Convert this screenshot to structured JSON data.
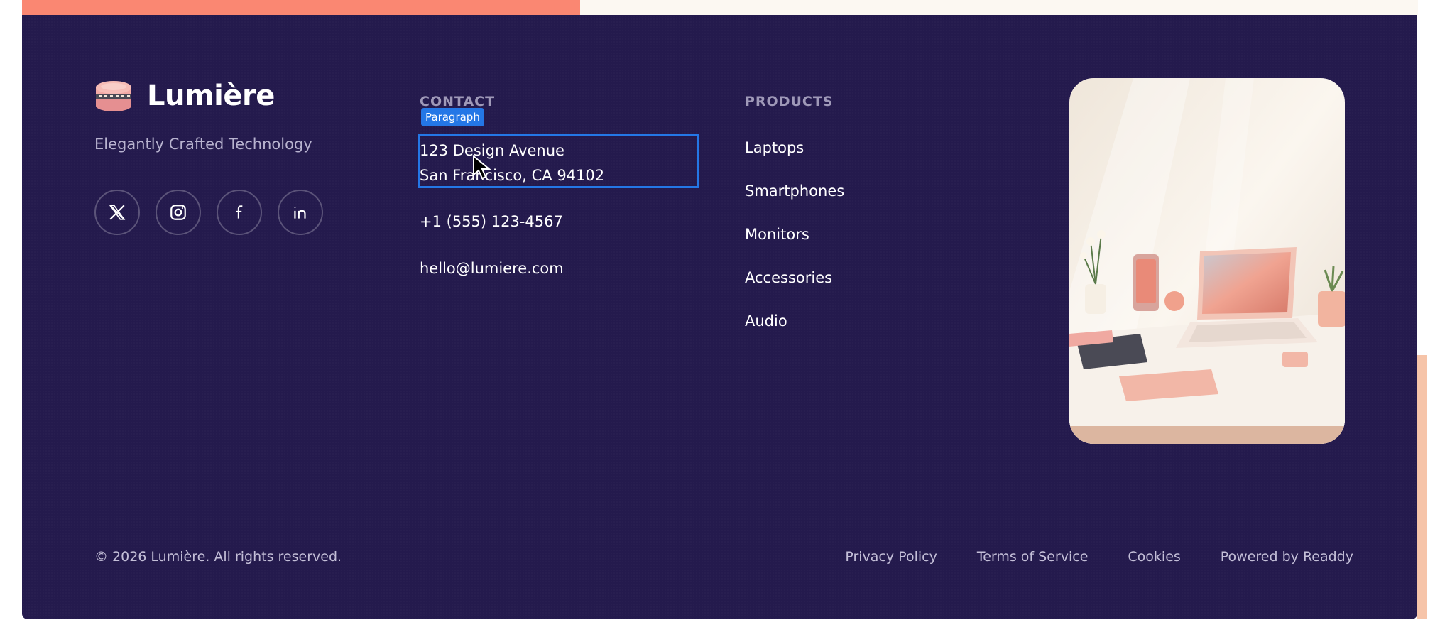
{
  "brand": {
    "name": "Lumière",
    "tagline": "Elegantly Crafted Technology"
  },
  "socials": [
    {
      "icon": "x-twitter-icon"
    },
    {
      "icon": "instagram-icon"
    },
    {
      "icon": "facebook-icon"
    },
    {
      "icon": "linkedin-icon"
    }
  ],
  "contact": {
    "heading": "CONTACT",
    "address_line1": "123 Design Avenue",
    "address_line2": "San Francisco, CA 94102",
    "phone": "+1 (555) 123-4567",
    "email": "hello@lumiere.com"
  },
  "products": {
    "heading": "PRODUCTS",
    "items": [
      "Laptops",
      "Smartphones",
      "Monitors",
      "Accessories",
      "Audio"
    ]
  },
  "editor": {
    "selection_tag": "Paragraph"
  },
  "bottom": {
    "copyright": "© 2026 Lumière. All rights reserved.",
    "links": [
      "Privacy Policy",
      "Terms of Service",
      "Cookies",
      "Powered by Readdy"
    ]
  },
  "colors": {
    "footer_bg": "#241a4d",
    "accent_coral": "#fa8772",
    "selection_blue": "#2477e6",
    "muted_text": "#b8b3cf"
  }
}
